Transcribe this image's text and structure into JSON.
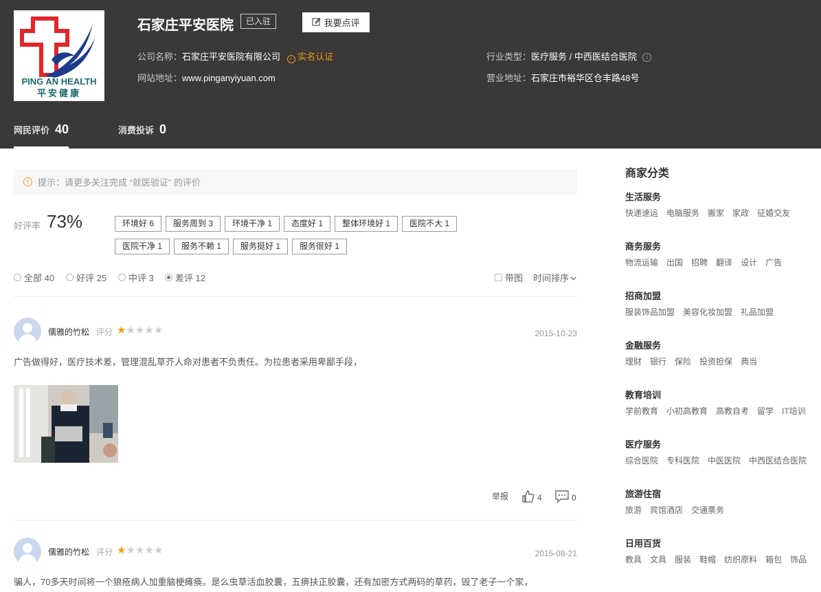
{
  "header": {
    "title": "石家庄平安医院",
    "badge": "已入驻",
    "review_button": "我要点评",
    "company_label": "公司名称：",
    "company_value": "石家庄平安医院有限公司",
    "verified": "实名认证",
    "industry_label": "行业类型：",
    "industry_value": "医疗服务 / 中西医结合医院",
    "website_label": "网站地址：",
    "website_value": "www.pinganyiyuan.com",
    "address_label": "营业地址：",
    "address_value": "石家庄市裕华区仓丰路48号",
    "logo_text_en": "PING AN HEALTH",
    "logo_text_cn": "平安健康"
  },
  "tabs": [
    {
      "label": "网民评价",
      "count": "40"
    },
    {
      "label": "消费投诉",
      "count": "0"
    }
  ],
  "tip": "提示：请更多关注完成 “就医验证” 的评价",
  "rating": {
    "label": "好评率",
    "value": "73%"
  },
  "tags": [
    "环境好 6",
    "服务周到 3",
    "环境干净 1",
    "态度好 1",
    "整体环境好 1",
    "医院不大 1",
    "医院干净 1",
    "服务不赖 1",
    "服务挺好 1",
    "服务很好 1"
  ],
  "filters": {
    "all": "全部 40",
    "good": "好评 25",
    "mid": "中评 3",
    "bad": "差评 12",
    "with_image": "带图",
    "sort": "时间排序"
  },
  "reviews": [
    {
      "user": "儒雅的竹松",
      "score_label": "评分",
      "stars": 1,
      "date": "2015-10-23",
      "content": "广告做得好，医疗技术差，管理混乱草芥人命对患者不负责任。为拉患者采用卑鄙手段，",
      "report": "举报",
      "likes": "4",
      "comments": "0"
    },
    {
      "user": "儒雅的竹松",
      "score_label": "评分",
      "stars": 1,
      "date": "2015-08-21",
      "content": "骗人，70多天时间将一个狼疮病人加重脑梗瘫痪。是么虫草活血胶囊，五痹扶正胶囊，还有加密方式两码的草药，毁了老子一个家，"
    }
  ],
  "sidebar": {
    "title": "商家分类",
    "categories": [
      {
        "name": "生活服务",
        "items": [
          "快递速运",
          "电脑服务",
          "搬家",
          "家政",
          "征婚交友"
        ]
      },
      {
        "name": "商务服务",
        "items": [
          "物流运输",
          "出国",
          "招聘",
          "翻译",
          "设计",
          "广告"
        ]
      },
      {
        "name": "招商加盟",
        "items": [
          "服装饰品加盟",
          "美容化妆加盟",
          "礼品加盟"
        ]
      },
      {
        "name": "金融服务",
        "items": [
          "理财",
          "银行",
          "保险",
          "投资担保",
          "典当"
        ]
      },
      {
        "name": "教育培训",
        "items": [
          "学前教育",
          "小初高教育",
          "高教自考",
          "留学",
          "IT培训"
        ]
      },
      {
        "name": "医疗服务",
        "items": [
          "综合医院",
          "专科医院",
          "中医医院",
          "中西医结合医院"
        ]
      },
      {
        "name": "旅游住宿",
        "items": [
          "旅游",
          "宾馆酒店",
          "交通票务"
        ]
      },
      {
        "name": "日用百货",
        "items": [
          "教具",
          "文具",
          "服装",
          "鞋帽",
          "纺织原料",
          "箱包",
          "饰品"
        ]
      }
    ]
  },
  "colors": {
    "header_bg": "#3a3838",
    "accent": "#f39c12"
  }
}
